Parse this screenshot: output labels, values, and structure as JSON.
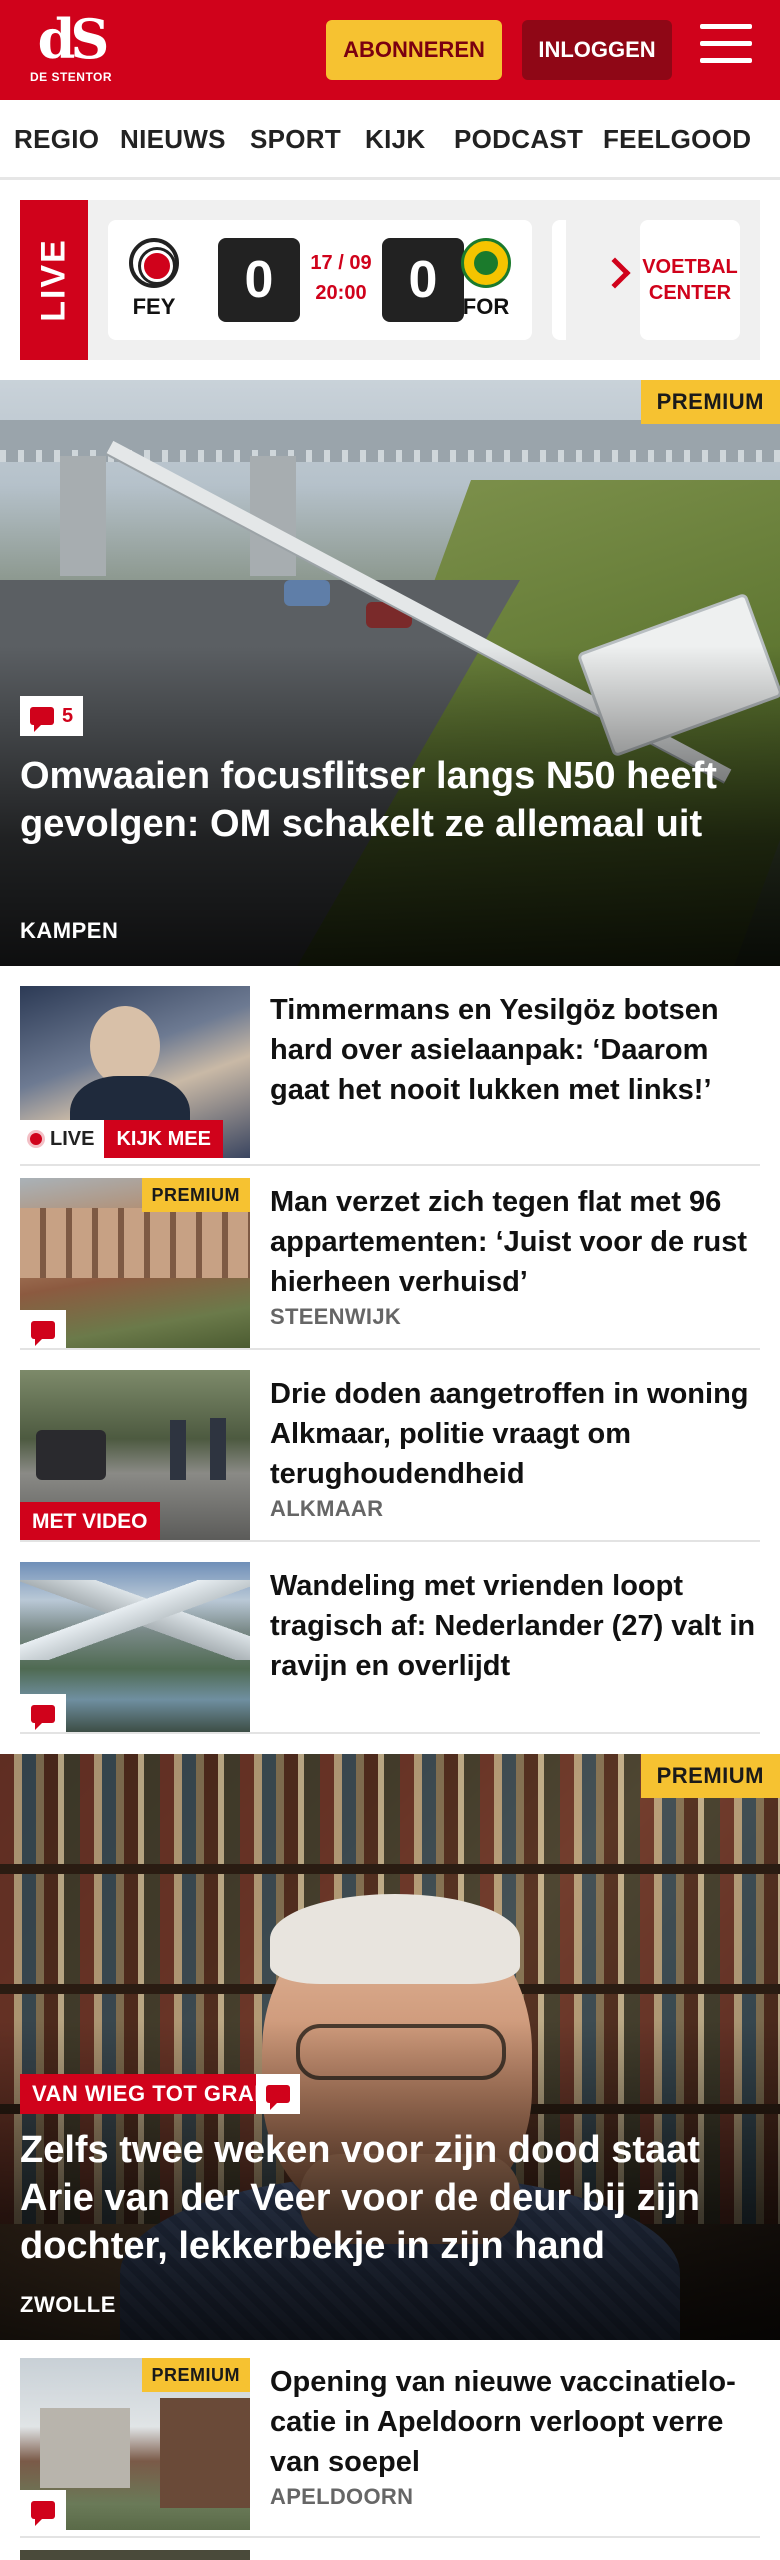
{
  "header": {
    "logo_mark": "dS",
    "logo_sub": "DE STENTOR",
    "subscribe_label": "ABONNEREN",
    "login_label": "INLOGGEN",
    "brand_color": "#d0021b",
    "accent_color": "#f6c231"
  },
  "nav": {
    "items": [
      "REGIO",
      "NIEUWS",
      "SPORT",
      "KIJK",
      "PODCAST",
      "FEELGOOD"
    ]
  },
  "live": {
    "tab_label": "LIVE",
    "match": {
      "home_abbr": "FEY",
      "home_score": "0",
      "away_abbr": "FOR",
      "away_score": "0",
      "date": "17 / 09",
      "time": "20:00"
    },
    "center_label_line1": "VOETBAL",
    "center_label_line2": "CENTER"
  },
  "hero1": {
    "badge": "PREMIUM",
    "comments": "5",
    "title": "Omwaaien focusflitser langs N50 heeft gevolgen: OM schakelt ze allemaal uit",
    "location": "KAMPEN"
  },
  "articles": [
    {
      "title": "Timmermans en Yesilgöz botsen hard over asielaanpak: ‘Daarom gaat het nooit lukken met links!’",
      "live_label": "LIVE",
      "watch_label": "KIJK MEE"
    },
    {
      "badge": "PREMIUM",
      "title": "Man verzet zich tegen flat met 96 appartementen: ‘Juist voor de rust hierheen verhuisd’",
      "location": "STEENWIJK"
    },
    {
      "video_label": "MET VIDEO",
      "title": "Drie doden aangetroffen in woning Alkmaar, politie vraagt om terughoudendheid",
      "location": "ALKMAAR"
    },
    {
      "title": "Wandeling met vrienden loopt tragisch af: Nederlander (27) valt in ravijn en overlijdt"
    }
  ],
  "hero2": {
    "badge": "PREMIUM",
    "series_label": "VAN WIEG TOT GRAF",
    "title": "Zelfs twee weken voor zijn dood staat Arie van der Veer voor de deur bij zijn dochter, lekkerbekje in zijn hand",
    "location": "ZWOLLE"
  },
  "article_after": {
    "badge": "PREMIUM",
    "title": "Opening van nieuwe vaccinatielo­catie in Apeldoorn verloopt verre van soepel",
    "location": "APELDOORN"
  }
}
